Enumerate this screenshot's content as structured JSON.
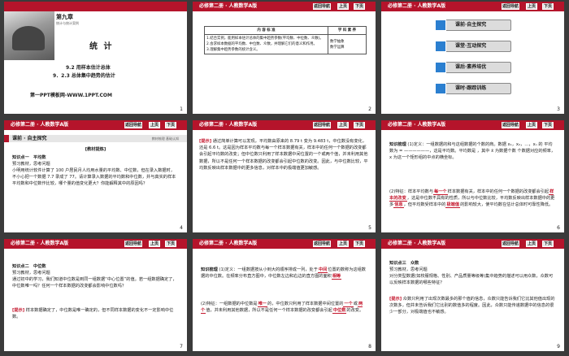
{
  "header": {
    "title": "必修第二册 · 人教数学A版",
    "nav_back": "返回导航",
    "nav_prev": "上页",
    "nav_next": "下页"
  },
  "s1": {
    "chapter": "第九章",
    "chapter_sub": "统计与统计案例",
    "title": "统 计",
    "sec1": "9.2   用样本估计总体",
    "sec2": "9．2.3   总体集中趋势的估计",
    "footer": "第一PPT模板网-WWW.1PPT.COM",
    "num": "1"
  },
  "s2": {
    "th1": "内 容 标 准",
    "th2": "学 科 素 养",
    "r1": "1.结合实例，能用样本估计总体的集中趋势参数(平均数、中位数、众数)。",
    "r2": "2.会求样本数据的平均数、中位数、众数，并理解它们的意义和作用。",
    "r3": "3.理解集中趋势参数的统计含义。",
    "s1": "数学抽象",
    "s2": "数学运算",
    "num": "2"
  },
  "s3": {
    "items": [
      "课前·自主探究",
      "课堂·互动探究",
      "课后·素养培优",
      "课时·跟踪训练"
    ],
    "num": "3"
  },
  "s4": {
    "sec": "课前 · 自主探究",
    "sec_sub": "教材梳理  基础认知",
    "center": "[教材提炼]",
    "k1": "知识点一　平均数",
    "k1b": "预习教材，思考问题",
    "q": "小明用统计软件计算了 100 户居民月人均用水量的平均数、中位数，但在录入数据时，不小心把一个数据 7.7 录成了 77。请计算录入数据的平均数和中位数，并与真实的样本平均数和中位数作比较，哪个量的值变化更大？你能解释其中的原因吗？",
    "num": "4"
  },
  "s5": {
    "tag": "[提示]",
    "body": "通过简单计算可以发现，平均数由原来的 8.79 t 变为 9.483 t，中位数没有变化，还是 6.6 t。这是因为样本平均数与每一个样本数据有关，样本中的任何一个数据的改变都会引起平均数的改变；但中位数只利用了样本数据中间位置的一个或两个值，并未利用其他数据，所以不是任何一个样本数据的改变都会引起中位数的改变。因此，与中位数比较，平均数反映出样本数据中的更多信息，对样本中的极端值更加敏感。",
    "num": "5"
  },
  "s6": {
    "l1a": "知识梳理",
    "l1b": "(1)定义：一组数据的和与这组数据的个数的商。数据 x₁，x₂，…，xₙ 的",
    "l2a": "平均数为",
    "l2b": "= ——————，这是平均数。平均数是",
    "l2c": "，其中 x̄ 为数据个数",
    "l3": "个数据对应的频率，x 为这一个矩形组的中点的横坐标。",
    "l4a": "(2)特征：样本平均数与",
    "l4b": "每一个",
    "l4c": "样本数据有关，样本中的任何一个数据的改变都会引起",
    "l4d": "样本的改变",
    "l4e": "，这是中位数不具有的性质，所以与中位数比较，平均数反映出样本数据中的更多",
    "l4f": "信息",
    "l4g": "，但平均数受样本中的",
    "l4h": "极端值",
    "l4i": "的影响较大，使平均数在估计总体时可靠性降低。",
    "num": "6"
  },
  "s7": {
    "k": "知识点二　中位数",
    "k2": "预习教材，思考问题",
    "q": "通过初中的学习，我们知道中位数是到同一组数据“中心位置”的值。若一组数据确定了，中位数唯一吗？任何一个样本数据的改变都会影响中位数吗？",
    "tag": "[提示]",
    "ans": "样本数据确定了，中位数是唯一确定的，但不同样本数据的变化不一定影响中位数。",
    "num": "7"
  },
  "s8": {
    "a": "知识梳理",
    "b": "(1)定义：一组数据按从小到大的顺序排成一列，处于",
    "c": "中间",
    "d": "位置的数称为这组数据的中位数。在频率分布直方图中，中位数左边和右边的直方图的面积",
    "e": "相等",
    "f": "(2)特征：一组数据的中位数是",
    "g": "唯一",
    "h": "的，中位数只利用了样本数据中间位置的",
    "i": "一个",
    "j": "或",
    "k": "两个",
    "l": "值，并未利用其他数据，所以不是任何一个样本数据的改变都会引起",
    "m": "中位数",
    "n": "的改变。",
    "num": "8"
  },
  "s9": {
    "k": "知识点三　众数",
    "k2": "预习教材，思考问题",
    "q": "对分类型数据(如校服规格、性别、产品质量等级等)集中趋势的描述可以用众数，众数可以反映样本数据的哪些特征？",
    "tag": "[提示]",
    "ans": "众数只利用了出现次数最多的那个值的信息，众数只能告诉我们它比其他值出现的次数多，但并未告诉我们它比别的数值多的程度。因此，众数只能传递数据中的信息的很少一部分，对极端值也不敏感。",
    "num": "9"
  }
}
